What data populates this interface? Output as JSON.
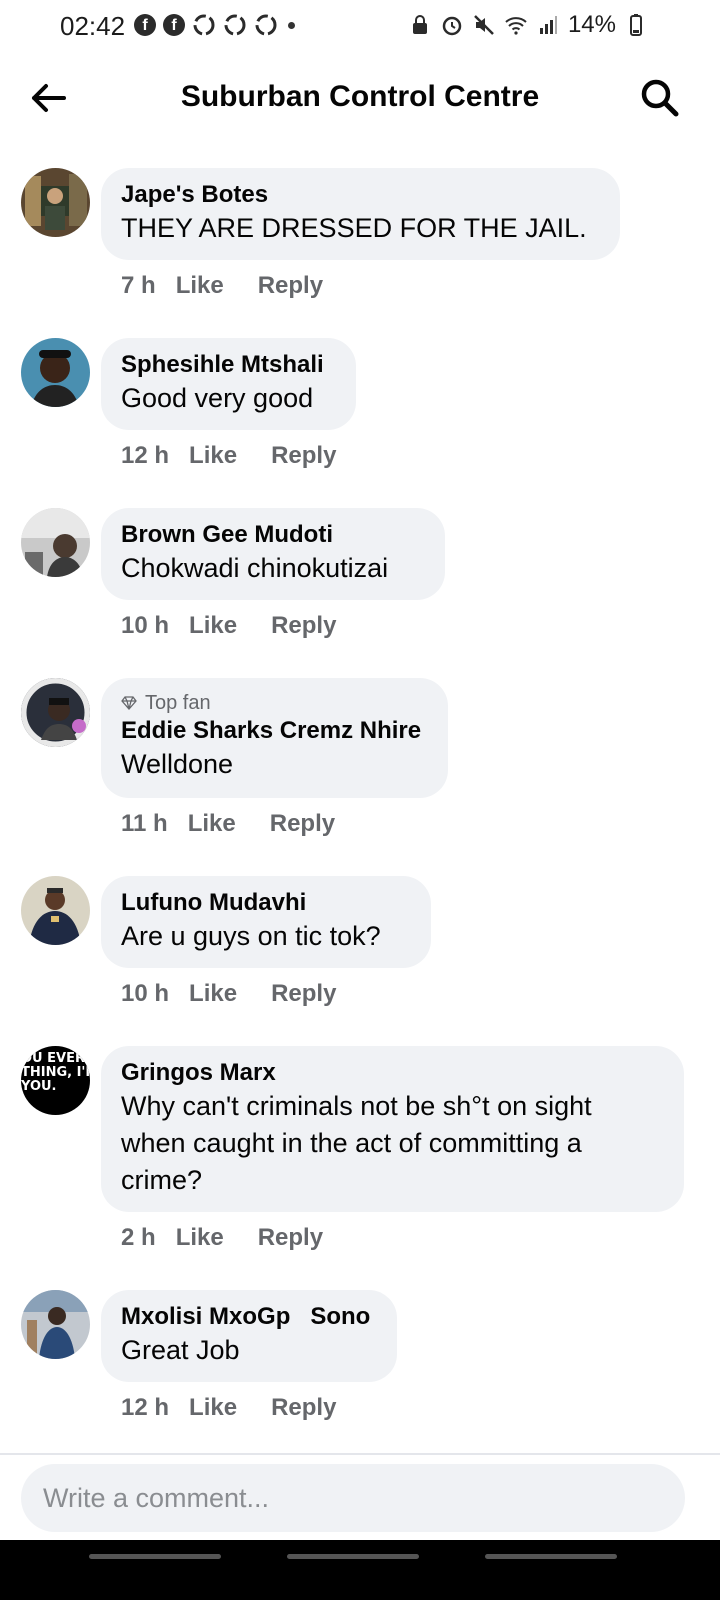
{
  "status_bar": {
    "time": "02:42",
    "battery": "14%",
    "left_icons": [
      "facebook-icon",
      "facebook-icon",
      "recycle-icon",
      "recycle-icon",
      "recycle-icon",
      "dot-icon"
    ],
    "right_icons": [
      "lock-icon",
      "alarm-icon",
      "mute-icon",
      "wifi-icon",
      "signal-icon",
      "battery-icon"
    ]
  },
  "header": {
    "title": "Suburban Control Centre",
    "back_icon": "arrow-left-icon",
    "search_icon": "search-icon"
  },
  "comments": [
    {
      "author": "Jape's Botes",
      "text": "THEY ARE DRESSED FOR THE JAIL.",
      "time": "7 h",
      "like": "Like",
      "reply": "Reply",
      "avatar_color": "#4a3b2a"
    },
    {
      "author": "Sphesihle Mtshali",
      "text": "Good very good",
      "time": "12 h",
      "like": "Like",
      "reply": "Reply",
      "avatar_color": "#3d7a9a"
    },
    {
      "author": "Brown Gee Mudoti",
      "text": "Chokwadi chinokutizai",
      "time": "10 h",
      "like": "Like",
      "reply": "Reply",
      "avatar_color": "#8a8d8f"
    },
    {
      "badge": "Top fan",
      "author": "Eddie Sharks Cremz Nhire",
      "text": "Welldone",
      "time": "11 h",
      "like": "Like",
      "reply": "Reply",
      "avatar_color": "#2a2f3a"
    },
    {
      "author": "Lufuno Mudavhi",
      "text": "Are u guys on tic tok?",
      "time": "10 h",
      "like": "Like",
      "reply": "Reply",
      "avatar_color": "#b9b5a6"
    },
    {
      "author": "Gringos Marx",
      "text_lines": [
        "Why can't criminals not be sh°t on sight",
        "when caught in the act of committing a",
        "crime?"
      ],
      "avatar_text": [
        "OU EVER N",
        "THING, I'M H",
        "YOU."
      ],
      "time": "2 h",
      "like": "Like",
      "reply": "Reply",
      "avatar_color": "#000000"
    },
    {
      "author": "Mxolisi MxoGp   Sono",
      "text": "Great Job",
      "time": "12 h",
      "like": "Like",
      "reply": "Reply",
      "avatar_color": "#3b5a7a"
    }
  ],
  "composer": {
    "placeholder": "Write a comment..."
  }
}
